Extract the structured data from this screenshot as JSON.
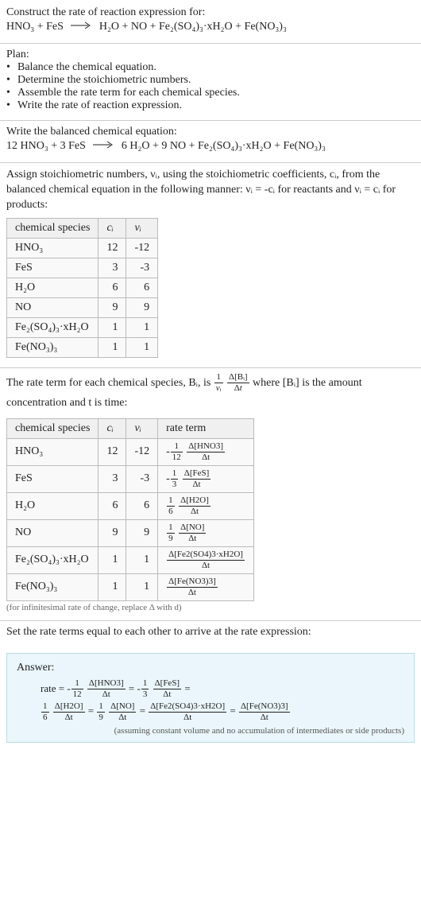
{
  "s1": {
    "line1": "Construct the rate of reaction expression for:",
    "eq_lhs": "HNO₃ + FeS",
    "eq_rhs": "H₂O + NO + Fe₂(SO₄)₃·xH₂O + Fe(NO₃)₃"
  },
  "s2": {
    "title": "Plan:",
    "b1": "Balance the chemical equation.",
    "b2": "Determine the stoichiometric numbers.",
    "b3": "Assemble the rate term for each chemical species.",
    "b4": "Write the rate of reaction expression."
  },
  "s3": {
    "line1": "Write the balanced chemical equation:",
    "eq_lhs": "12 HNO₃ + 3 FeS",
    "eq_rhs": "6 H₂O + 9 NO + Fe₂(SO₄)₃·xH₂O + Fe(NO₃)₃"
  },
  "s4": {
    "intro1": "Assign stoichiometric numbers, νᵢ, using the stoichiometric coefficients, cᵢ, from the balanced chemical equation in the following manner: νᵢ = -cᵢ for reactants and νᵢ = cᵢ for products:",
    "h1": "chemical species",
    "h2": "cᵢ",
    "h3": "νᵢ",
    "rows": [
      {
        "sp": "HNO₃",
        "c": "12",
        "v": "-12"
      },
      {
        "sp": "FeS",
        "c": "3",
        "v": "-3"
      },
      {
        "sp": "H₂O",
        "c": "6",
        "v": "6"
      },
      {
        "sp": "NO",
        "c": "9",
        "v": "9"
      },
      {
        "sp": "Fe₂(SO₄)₃·xH₂O",
        "c": "1",
        "v": "1"
      },
      {
        "sp": "Fe(NO₃)₃",
        "c": "1",
        "v": "1"
      }
    ]
  },
  "s5": {
    "intro_a": "The rate term for each chemical species, Bᵢ, is",
    "intro_b": "where [Bᵢ] is the amount concentration and t is time:",
    "h1": "chemical species",
    "h2": "cᵢ",
    "h3": "νᵢ",
    "h4": "rate term",
    "rows": [
      {
        "sp": "HNO₃",
        "c": "12",
        "v": "-12",
        "sign": "-",
        "coef_num": "1",
        "coef_den": "12",
        "d_num": "Δ[HNO3]",
        "d_den": "Δt"
      },
      {
        "sp": "FeS",
        "c": "3",
        "v": "-3",
        "sign": "-",
        "coef_num": "1",
        "coef_den": "3",
        "d_num": "Δ[FeS]",
        "d_den": "Δt"
      },
      {
        "sp": "H₂O",
        "c": "6",
        "v": "6",
        "sign": "",
        "coef_num": "1",
        "coef_den": "6",
        "d_num": "Δ[H2O]",
        "d_den": "Δt"
      },
      {
        "sp": "NO",
        "c": "9",
        "v": "9",
        "sign": "",
        "coef_num": "1",
        "coef_den": "9",
        "d_num": "Δ[NO]",
        "d_den": "Δt"
      },
      {
        "sp": "Fe₂(SO₄)₃·xH₂O",
        "c": "1",
        "v": "1",
        "sign": "",
        "coef_num": "",
        "coef_den": "",
        "d_num": "Δ[Fe2(SO4)3·xH2O]",
        "d_den": "Δt"
      },
      {
        "sp": "Fe(NO₃)₃",
        "c": "1",
        "v": "1",
        "sign": "",
        "coef_num": "",
        "coef_den": "",
        "d_num": "Δ[Fe(NO3)3]",
        "d_den": "Δt"
      }
    ],
    "note": "(for infinitesimal rate of change, replace Δ with d)"
  },
  "s6": {
    "line1": "Set the rate terms equal to each other to arrive at the rate expression:"
  },
  "ans": {
    "title": "Answer:",
    "prefix": "rate =",
    "terms": [
      {
        "sign": "-",
        "coef_num": "1",
        "coef_den": "12",
        "d_num": "Δ[HNO3]",
        "d_den": "Δt"
      },
      {
        "sign": "-",
        "coef_num": "1",
        "coef_den": "3",
        "d_num": "Δ[FeS]",
        "d_den": "Δt"
      },
      {
        "sign": "",
        "coef_num": "1",
        "coef_den": "6",
        "d_num": "Δ[H2O]",
        "d_den": "Δt"
      },
      {
        "sign": "",
        "coef_num": "1",
        "coef_den": "9",
        "d_num": "Δ[NO]",
        "d_den": "Δt"
      },
      {
        "sign": "",
        "coef_num": "",
        "coef_den": "",
        "d_num": "Δ[Fe2(SO4)3·xH2O]",
        "d_den": "Δt"
      },
      {
        "sign": "",
        "coef_num": "",
        "coef_den": "",
        "d_num": "Δ[Fe(NO3)3]",
        "d_den": "Δt"
      }
    ],
    "note": "(assuming constant volume and no accumulation of intermediates or side products)"
  }
}
